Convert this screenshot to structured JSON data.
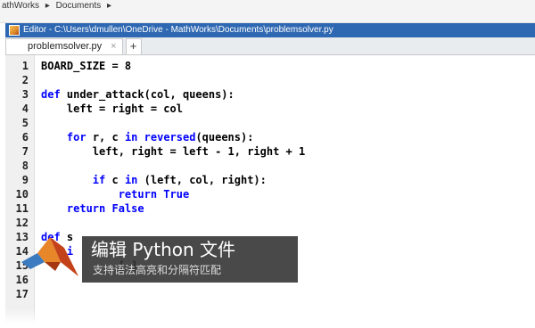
{
  "breadcrumb": [
    "athWorks",
    "Documents"
  ],
  "window": {
    "title": "Editor - C:\\Users\\dmullen\\OneDrive - MathWorks\\Documents\\problemsolver.py"
  },
  "tabs": [
    {
      "label": "problemsolver.py",
      "close": "×"
    }
  ],
  "tab_add": "+",
  "editor": {
    "lines": [
      {
        "n": "1",
        "segs": [
          {
            "t": "BOARD_SIZE = 8"
          }
        ]
      },
      {
        "n": "2",
        "segs": []
      },
      {
        "n": "3",
        "segs": [
          {
            "t": "def",
            "c": "kw"
          },
          {
            "t": " under_attack(col, queens):"
          }
        ]
      },
      {
        "n": "4",
        "segs": [
          {
            "t": "    left = right = col"
          }
        ]
      },
      {
        "n": "5",
        "segs": []
      },
      {
        "n": "6",
        "segs": [
          {
            "t": "    "
          },
          {
            "t": "for",
            "c": "kw"
          },
          {
            "t": " r, c "
          },
          {
            "t": "in",
            "c": "kw"
          },
          {
            "t": " "
          },
          {
            "t": "reversed",
            "c": "kw"
          },
          {
            "t": "(queens):"
          }
        ]
      },
      {
        "n": "7",
        "segs": [
          {
            "t": "        left, right = left - 1, right + 1"
          }
        ]
      },
      {
        "n": "8",
        "segs": []
      },
      {
        "n": "9",
        "segs": [
          {
            "t": "        "
          },
          {
            "t": "if",
            "c": "kw"
          },
          {
            "t": " c "
          },
          {
            "t": "in",
            "c": "kw"
          },
          {
            "t": " (left, col, right):"
          }
        ]
      },
      {
        "n": "10",
        "segs": [
          {
            "t": "            "
          },
          {
            "t": "return",
            "c": "kw"
          },
          {
            "t": " "
          },
          {
            "t": "True",
            "c": "kw"
          }
        ]
      },
      {
        "n": "11",
        "segs": [
          {
            "t": "    "
          },
          {
            "t": "return",
            "c": "kw"
          },
          {
            "t": " "
          },
          {
            "t": "False",
            "c": "kw"
          }
        ]
      },
      {
        "n": "12",
        "segs": []
      },
      {
        "n": "13",
        "segs": [
          {
            "t": "def",
            "c": "kw"
          },
          {
            "t": " s"
          }
        ]
      },
      {
        "n": "14",
        "segs": [
          {
            "t": "    "
          },
          {
            "t": "i",
            "c": "kw"
          }
        ]
      },
      {
        "n": "15",
        "segs": [
          {
            "t": "            [ ]"
          }
        ]
      },
      {
        "n": "16",
        "segs": []
      },
      {
        "n": "17",
        "segs": []
      }
    ]
  },
  "overlay": {
    "title": "编辑 Python 文件",
    "subtitle": "支持语法高亮和分隔符匹配"
  },
  "colors": {
    "keyword": "#0000ff",
    "titlebar": "#2f68b2",
    "banner": "#303030"
  }
}
